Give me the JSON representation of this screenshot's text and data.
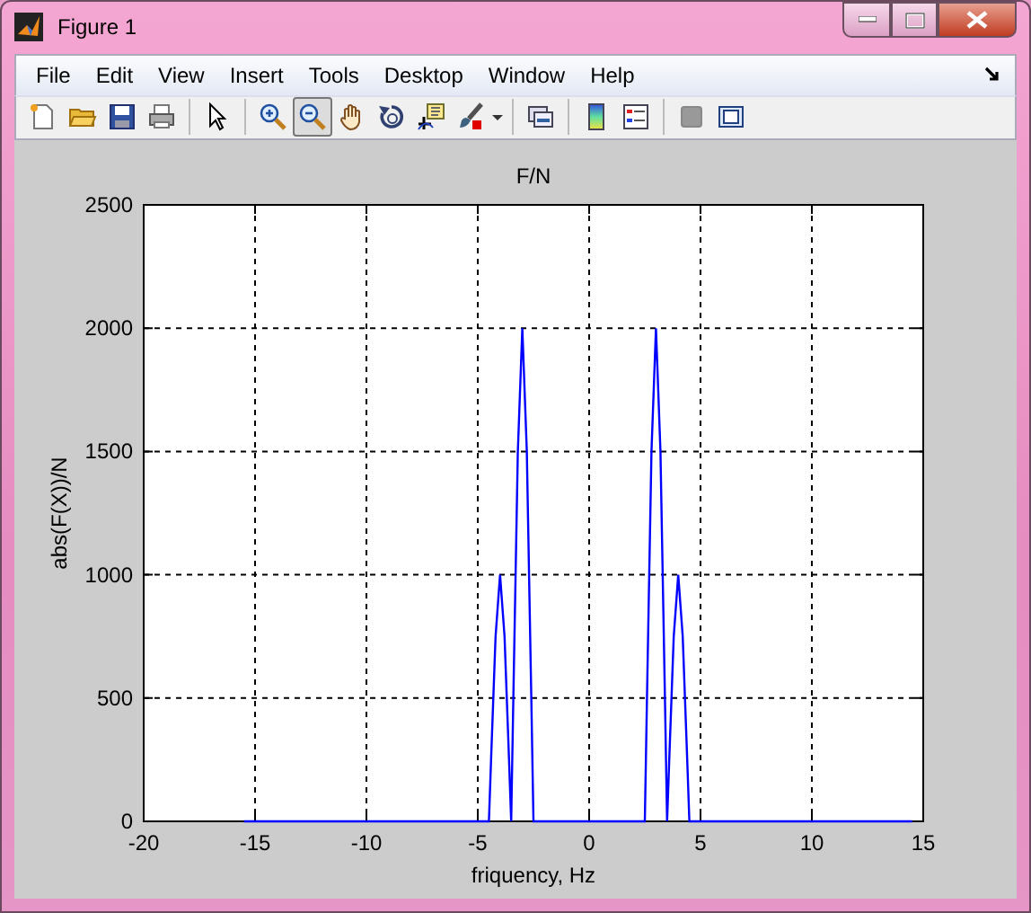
{
  "window": {
    "title": "Figure 1"
  },
  "menu": [
    "File",
    "Edit",
    "View",
    "Insert",
    "Tools",
    "Desktop",
    "Window",
    "Help"
  ],
  "toolbar": [
    {
      "kind": "new",
      "selected": false
    },
    {
      "kind": "open",
      "selected": false
    },
    {
      "kind": "save",
      "selected": false
    },
    {
      "kind": "print",
      "selected": false
    },
    {
      "kind": "separator"
    },
    {
      "kind": "pointer",
      "selected": false
    },
    {
      "kind": "separator"
    },
    {
      "kind": "zoomin",
      "selected": false
    },
    {
      "kind": "zoomout",
      "selected": true
    },
    {
      "kind": "pan",
      "selected": false
    },
    {
      "kind": "rotate",
      "selected": false
    },
    {
      "kind": "cursor",
      "selected": false
    },
    {
      "kind": "brush",
      "selected": false
    },
    {
      "kind": "caret"
    },
    {
      "kind": "separator"
    },
    {
      "kind": "link",
      "selected": false
    },
    {
      "kind": "separator"
    },
    {
      "kind": "colorbar",
      "selected": false
    },
    {
      "kind": "legend",
      "selected": false
    },
    {
      "kind": "separator"
    },
    {
      "kind": "hide",
      "selected": false
    },
    {
      "kind": "show",
      "selected": false
    }
  ],
  "plot": {
    "chart_data": {
      "type": "line",
      "title": "F/N",
      "xlabel": "friquency, Hz",
      "ylabel": "abs(F(X))/N",
      "xlim": [
        -20,
        15
      ],
      "ylim": [
        0,
        2500
      ],
      "xticks": [
        -20,
        -15,
        -10,
        -5,
        0,
        5,
        10,
        15
      ],
      "yticks": [
        0,
        500,
        1000,
        1500,
        2000,
        2500
      ],
      "grid": true,
      "series": [
        {
          "color": "#0000ff",
          "x": [
            -15.5,
            -4.5,
            -4.4,
            -4.2,
            -4.0,
            -3.8,
            -3.6,
            -3.5,
            -3.4,
            -3.2,
            -3.0,
            -2.8,
            -2.6,
            -2.5,
            2.5,
            2.6,
            2.8,
            3.0,
            3.2,
            3.4,
            3.5,
            3.6,
            3.8,
            4.0,
            4.2,
            4.4,
            4.5,
            14.5
          ],
          "values": [
            0,
            0,
            250,
            750,
            1000,
            750,
            250,
            0,
            500,
            1500,
            2000,
            1500,
            500,
            0,
            0,
            500,
            1500,
            2000,
            1500,
            500,
            0,
            250,
            750,
            1000,
            750,
            250,
            0,
            0
          ]
        }
      ]
    }
  }
}
